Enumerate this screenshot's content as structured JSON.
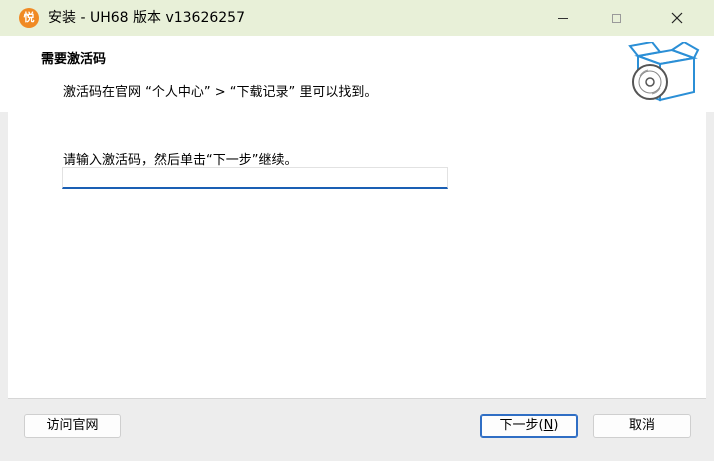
{
  "window": {
    "title": "安装 - UH68 版本 v13626257",
    "app_icon_glyph": "悦"
  },
  "header": {
    "title": "需要激活码",
    "subtitle": "激活码在官网 “个人中心” > “下载记录” 里可以找到。"
  },
  "body": {
    "prompt": "请输入激活码，然后单击“下一步”继续。",
    "code_input_value": ""
  },
  "buttons": {
    "website": "访问官网",
    "next_prefix": "下一步(",
    "next_key": "N",
    "next_suffix": ")",
    "cancel": "取消"
  },
  "colors": {
    "titlebar_bg": "#e8f0d8",
    "accent": "#1a5fb4",
    "app_icon": "#f08a24",
    "art_blue": "#2b8fd6"
  },
  "icons": {
    "app": "app-logo-icon",
    "header_art": "box-disc-icon",
    "minimize": "minimize-icon",
    "maximize": "maximize-icon",
    "close": "close-icon"
  }
}
